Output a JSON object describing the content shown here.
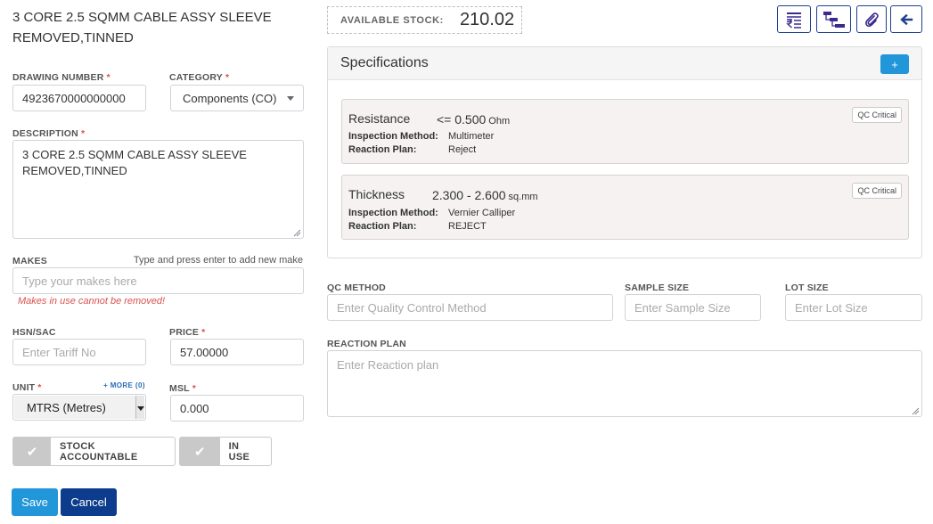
{
  "item": {
    "title": "3 CORE 2.5 SQMM CABLE ASSY SLEEVE REMOVED,TINNED"
  },
  "form": {
    "drawing_number": {
      "label": "DRAWING NUMBER",
      "req": "*",
      "value": "4923670000000000"
    },
    "category": {
      "label": "CATEGORY",
      "req": "*",
      "value": "Components (CO)"
    },
    "description": {
      "label": "DESCRIPTION",
      "req": "*",
      "value": "3 CORE 2.5 SQMM CABLE ASSY SLEEVE REMOVED,TINNED"
    },
    "makes": {
      "label": "MAKES",
      "hint": "Type and press enter to add new make",
      "placeholder": "Type your makes here",
      "error": "Makes in use cannot be removed!"
    },
    "hsn": {
      "label": "HSN/SAC",
      "placeholder": "Enter Tariff No"
    },
    "price": {
      "label": "PRICE",
      "req": "*",
      "value": "57.00000"
    },
    "unit": {
      "label": "UNIT",
      "req": "*",
      "more": "+ MORE (0)",
      "value": "MTRS (Metres)"
    },
    "msl": {
      "label": "MSL",
      "req": "*",
      "value": "0.000"
    },
    "toggles": {
      "stock_accountable": "STOCK ACCOUNTABLE",
      "in_use": "IN USE"
    },
    "buttons": {
      "save": "Save",
      "cancel": "Cancel"
    }
  },
  "stock": {
    "label": "AVAILABLE STOCK:",
    "value": "210.02"
  },
  "toolbar": {
    "icons": [
      "price-list-icon",
      "hierarchy-icon",
      "attachment-icon",
      "back-arrow-icon"
    ]
  },
  "specifications": {
    "title": "Specifications",
    "add_label": "+",
    "items": [
      {
        "name": "Resistance",
        "range": "<= 0.500",
        "unit": "Ohm",
        "badge": "QC Critical",
        "method_label": "Inspection Method:",
        "method": "Multimeter",
        "plan_label": "Reaction Plan:",
        "plan": "Reject"
      },
      {
        "name": "Thickness",
        "range": "2.300 - 2.600",
        "unit": "sq.mm",
        "badge": "QC Critical",
        "method_label": "Inspection Method:",
        "method": "Vernier Calliper",
        "plan_label": "Reaction Plan:",
        "plan": "REJECT"
      }
    ]
  },
  "qc": {
    "method": {
      "label": "QC METHOD",
      "placeholder": "Enter Quality Control Method"
    },
    "sample": {
      "label": "SAMPLE SIZE",
      "placeholder": "Enter Sample Size"
    },
    "lot": {
      "label": "LOT SIZE",
      "placeholder": "Enter Lot Size"
    },
    "reaction": {
      "label": "REACTION PLAN",
      "placeholder": "Enter Reaction plan"
    }
  },
  "colors": {
    "primary": "#2196d9",
    "dark": "#0d3c8c",
    "required": "#d9534f",
    "toolbar_icon": "#3b2a8f"
  }
}
